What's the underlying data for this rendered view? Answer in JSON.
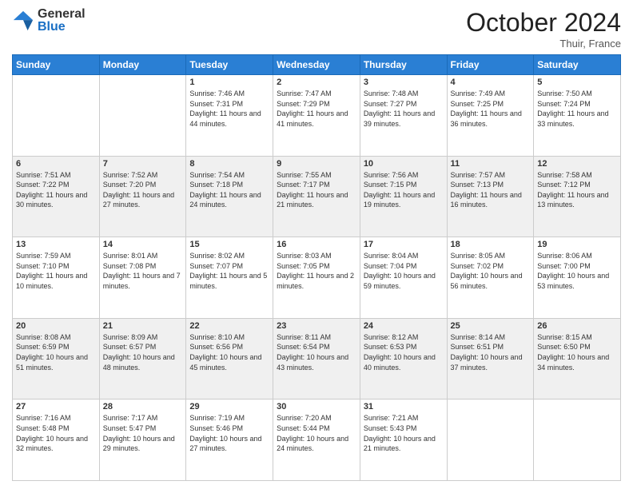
{
  "header": {
    "logo_general": "General",
    "logo_blue": "Blue",
    "month_title": "October 2024",
    "location": "Thuir, France"
  },
  "weekdays": [
    "Sunday",
    "Monday",
    "Tuesday",
    "Wednesday",
    "Thursday",
    "Friday",
    "Saturday"
  ],
  "weeks": [
    [
      {
        "day": "",
        "info": ""
      },
      {
        "day": "",
        "info": ""
      },
      {
        "day": "1",
        "info": "Sunrise: 7:46 AM\nSunset: 7:31 PM\nDaylight: 11 hours and 44 minutes."
      },
      {
        "day": "2",
        "info": "Sunrise: 7:47 AM\nSunset: 7:29 PM\nDaylight: 11 hours and 41 minutes."
      },
      {
        "day": "3",
        "info": "Sunrise: 7:48 AM\nSunset: 7:27 PM\nDaylight: 11 hours and 39 minutes."
      },
      {
        "day": "4",
        "info": "Sunrise: 7:49 AM\nSunset: 7:25 PM\nDaylight: 11 hours and 36 minutes."
      },
      {
        "day": "5",
        "info": "Sunrise: 7:50 AM\nSunset: 7:24 PM\nDaylight: 11 hours and 33 minutes."
      }
    ],
    [
      {
        "day": "6",
        "info": "Sunrise: 7:51 AM\nSunset: 7:22 PM\nDaylight: 11 hours and 30 minutes."
      },
      {
        "day": "7",
        "info": "Sunrise: 7:52 AM\nSunset: 7:20 PM\nDaylight: 11 hours and 27 minutes."
      },
      {
        "day": "8",
        "info": "Sunrise: 7:54 AM\nSunset: 7:18 PM\nDaylight: 11 hours and 24 minutes."
      },
      {
        "day": "9",
        "info": "Sunrise: 7:55 AM\nSunset: 7:17 PM\nDaylight: 11 hours and 21 minutes."
      },
      {
        "day": "10",
        "info": "Sunrise: 7:56 AM\nSunset: 7:15 PM\nDaylight: 11 hours and 19 minutes."
      },
      {
        "day": "11",
        "info": "Sunrise: 7:57 AM\nSunset: 7:13 PM\nDaylight: 11 hours and 16 minutes."
      },
      {
        "day": "12",
        "info": "Sunrise: 7:58 AM\nSunset: 7:12 PM\nDaylight: 11 hours and 13 minutes."
      }
    ],
    [
      {
        "day": "13",
        "info": "Sunrise: 7:59 AM\nSunset: 7:10 PM\nDaylight: 11 hours and 10 minutes."
      },
      {
        "day": "14",
        "info": "Sunrise: 8:01 AM\nSunset: 7:08 PM\nDaylight: 11 hours and 7 minutes."
      },
      {
        "day": "15",
        "info": "Sunrise: 8:02 AM\nSunset: 7:07 PM\nDaylight: 11 hours and 5 minutes."
      },
      {
        "day": "16",
        "info": "Sunrise: 8:03 AM\nSunset: 7:05 PM\nDaylight: 11 hours and 2 minutes."
      },
      {
        "day": "17",
        "info": "Sunrise: 8:04 AM\nSunset: 7:04 PM\nDaylight: 10 hours and 59 minutes."
      },
      {
        "day": "18",
        "info": "Sunrise: 8:05 AM\nSunset: 7:02 PM\nDaylight: 10 hours and 56 minutes."
      },
      {
        "day": "19",
        "info": "Sunrise: 8:06 AM\nSunset: 7:00 PM\nDaylight: 10 hours and 53 minutes."
      }
    ],
    [
      {
        "day": "20",
        "info": "Sunrise: 8:08 AM\nSunset: 6:59 PM\nDaylight: 10 hours and 51 minutes."
      },
      {
        "day": "21",
        "info": "Sunrise: 8:09 AM\nSunset: 6:57 PM\nDaylight: 10 hours and 48 minutes."
      },
      {
        "day": "22",
        "info": "Sunrise: 8:10 AM\nSunset: 6:56 PM\nDaylight: 10 hours and 45 minutes."
      },
      {
        "day": "23",
        "info": "Sunrise: 8:11 AM\nSunset: 6:54 PM\nDaylight: 10 hours and 43 minutes."
      },
      {
        "day": "24",
        "info": "Sunrise: 8:12 AM\nSunset: 6:53 PM\nDaylight: 10 hours and 40 minutes."
      },
      {
        "day": "25",
        "info": "Sunrise: 8:14 AM\nSunset: 6:51 PM\nDaylight: 10 hours and 37 minutes."
      },
      {
        "day": "26",
        "info": "Sunrise: 8:15 AM\nSunset: 6:50 PM\nDaylight: 10 hours and 34 minutes."
      }
    ],
    [
      {
        "day": "27",
        "info": "Sunrise: 7:16 AM\nSunset: 5:48 PM\nDaylight: 10 hours and 32 minutes."
      },
      {
        "day": "28",
        "info": "Sunrise: 7:17 AM\nSunset: 5:47 PM\nDaylight: 10 hours and 29 minutes."
      },
      {
        "day": "29",
        "info": "Sunrise: 7:19 AM\nSunset: 5:46 PM\nDaylight: 10 hours and 27 minutes."
      },
      {
        "day": "30",
        "info": "Sunrise: 7:20 AM\nSunset: 5:44 PM\nDaylight: 10 hours and 24 minutes."
      },
      {
        "day": "31",
        "info": "Sunrise: 7:21 AM\nSunset: 5:43 PM\nDaylight: 10 hours and 21 minutes."
      },
      {
        "day": "",
        "info": ""
      },
      {
        "day": "",
        "info": ""
      }
    ]
  ]
}
